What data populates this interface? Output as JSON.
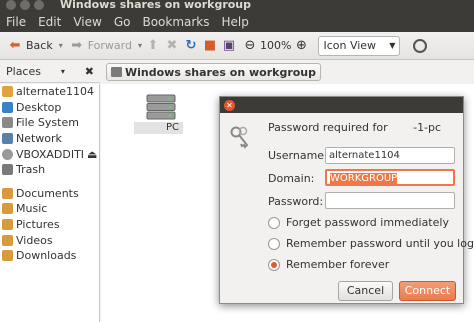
{
  "window": {
    "title": "Windows shares on workgroup"
  },
  "menu": [
    "File",
    "Edit",
    "View",
    "Go",
    "Bookmarks",
    "Help"
  ],
  "toolbar": {
    "back": "Back",
    "forward": "Forward",
    "zoom": "100%",
    "view_mode": "Icon View"
  },
  "places": {
    "header": "Places",
    "items": [
      {
        "label": "alternate1104",
        "icon": "home-folder-icon",
        "color": "#e2a33d"
      },
      {
        "label": "Desktop",
        "icon": "desktop-icon",
        "color": "#3b82c4"
      },
      {
        "label": "File System",
        "icon": "harddisk-icon",
        "color": "#8a8a8a"
      },
      {
        "label": "Network",
        "icon": "network-icon",
        "color": "#5a7fa8"
      },
      {
        "label": "VBOXADDITI",
        "icon": "optical-disc-icon",
        "color": "#9a9a9a"
      },
      {
        "label": "Trash",
        "icon": "trash-icon",
        "color": "#7a7a7a"
      },
      {
        "label": "Documents",
        "icon": "folder-icon",
        "color": "#d89a3c"
      },
      {
        "label": "Music",
        "icon": "folder-icon",
        "color": "#d89a3c"
      },
      {
        "label": "Pictures",
        "icon": "folder-icon",
        "color": "#d89a3c"
      },
      {
        "label": "Videos",
        "icon": "folder-icon",
        "color": "#d89a3c"
      },
      {
        "label": "Downloads",
        "icon": "folder-icon",
        "color": "#d89a3c"
      }
    ]
  },
  "path": {
    "current": "Windows shares on workgroup"
  },
  "content": {
    "server_label": "PC"
  },
  "dialog": {
    "prompt": "Password required for",
    "host_suffix": "-1-pc",
    "username_label": "Username:",
    "username_value": "alternate1104",
    "domain_label": "Domain:",
    "domain_value": "WORKGROUP",
    "password_label": "Password:",
    "password_value": "",
    "options": [
      {
        "label": "Forget password immediately",
        "checked": false
      },
      {
        "label": "Remember password until you logout",
        "checked": false
      },
      {
        "label": "Remember forever",
        "checked": true
      }
    ],
    "cancel": "Cancel",
    "connect": "Connect"
  },
  "colors": {
    "accent": "#f07746",
    "titlebar": "#3c3b37"
  }
}
